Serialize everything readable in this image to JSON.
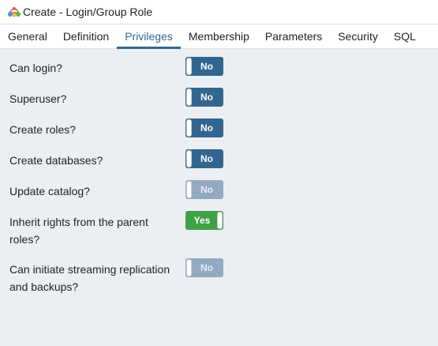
{
  "title": "Create - Login/Group Role",
  "tabs": [
    "General",
    "Definition",
    "Privileges",
    "Membership",
    "Parameters",
    "Security",
    "SQL"
  ],
  "active_tab": "Privileges",
  "privileges": [
    {
      "label": "Can login?",
      "value": "No",
      "state": "off",
      "disabled": false
    },
    {
      "label": "Superuser?",
      "value": "No",
      "state": "off",
      "disabled": false
    },
    {
      "label": "Create roles?",
      "value": "No",
      "state": "off",
      "disabled": false
    },
    {
      "label": "Create databases?",
      "value": "No",
      "state": "off",
      "disabled": false
    },
    {
      "label": "Update catalog?",
      "value": "No",
      "state": "off",
      "disabled": true
    },
    {
      "label": "Inherit rights from the parent roles?",
      "value": "Yes",
      "state": "on",
      "disabled": false
    },
    {
      "label": "Can initiate streaming replication and backups?",
      "value": "No",
      "state": "off",
      "disabled": true
    }
  ],
  "colors": {
    "accent": "#326690",
    "on": "#3fa146",
    "disabled": "#94aac3"
  }
}
